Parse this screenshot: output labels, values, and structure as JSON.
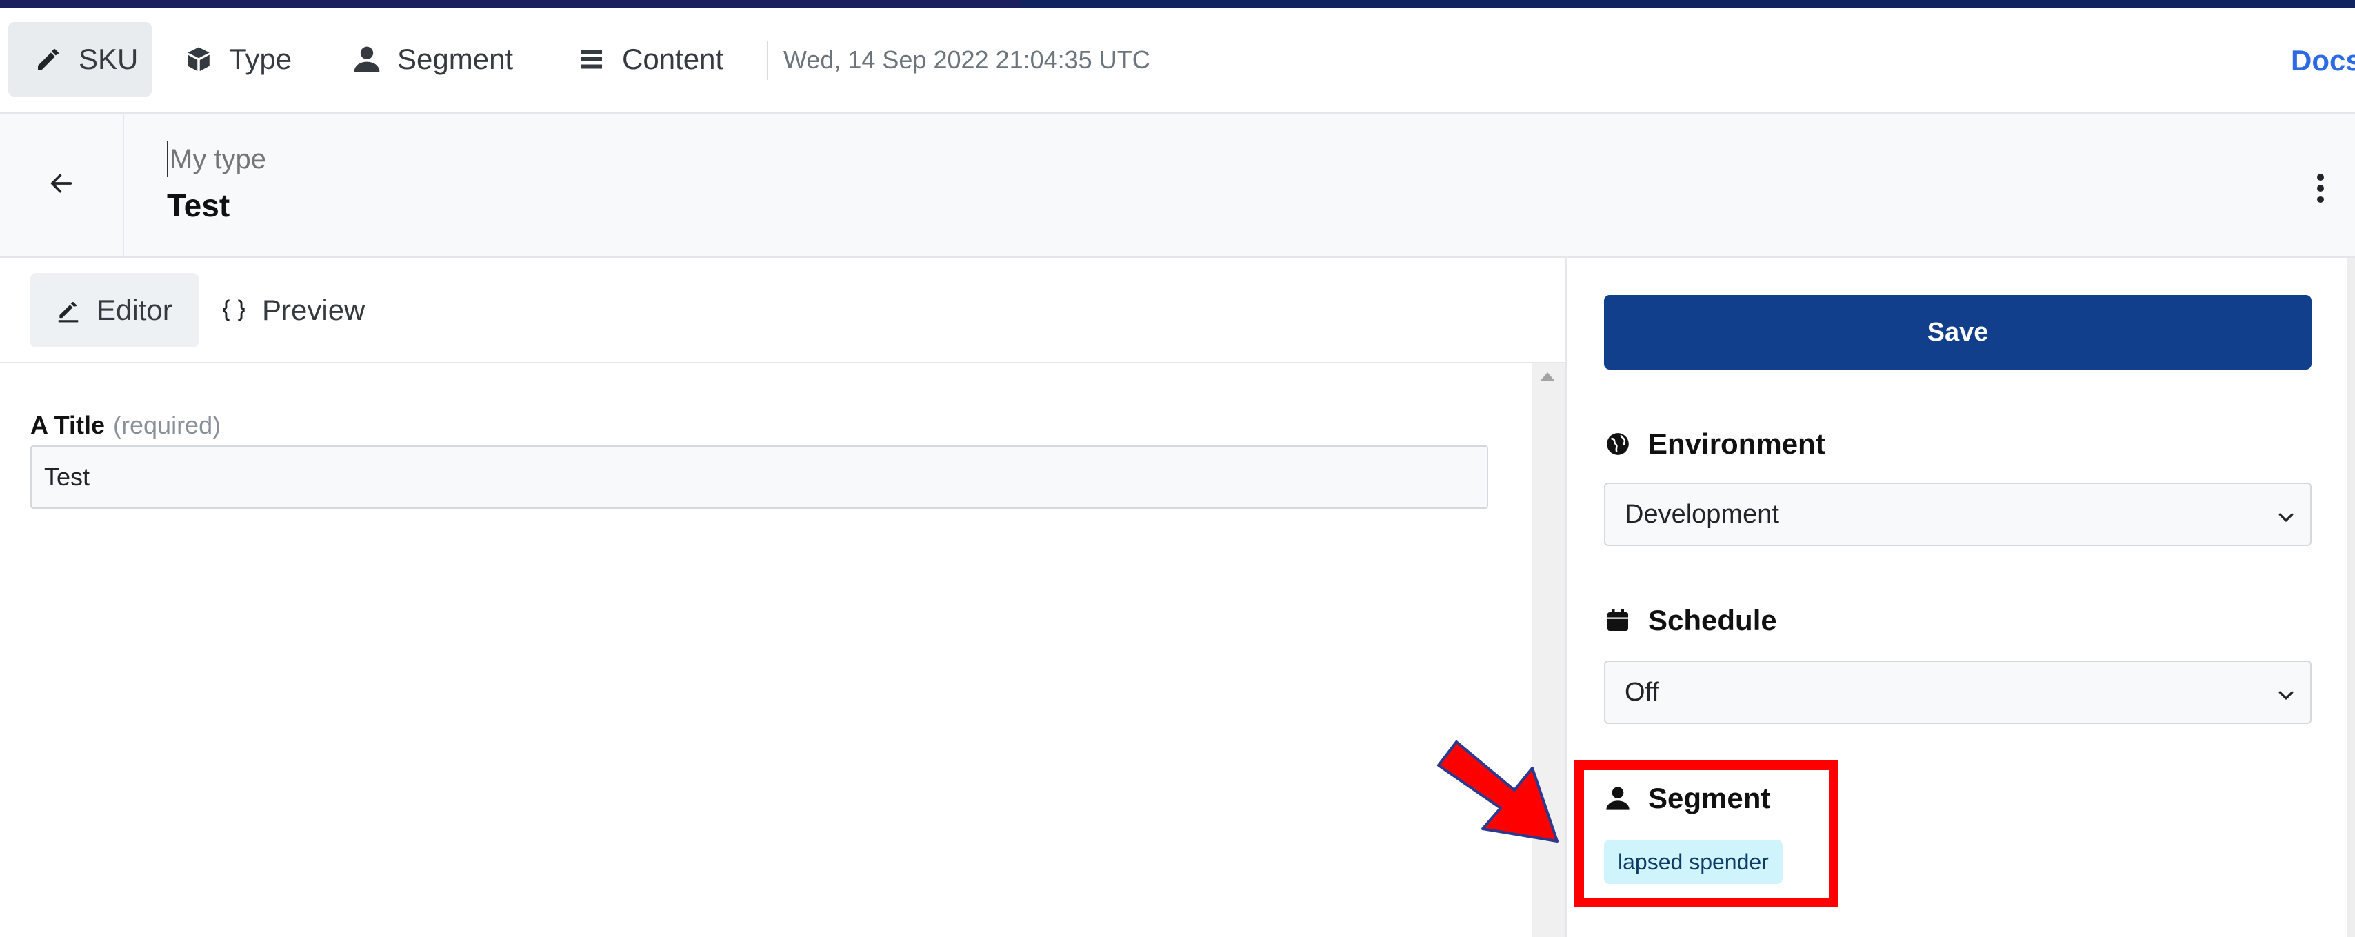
{
  "topnav": {
    "items": [
      {
        "label": "SKU",
        "icon": "pencil-icon",
        "active": true
      },
      {
        "label": "Type",
        "icon": "cube-icon"
      },
      {
        "label": "Segment",
        "icon": "user-icon"
      },
      {
        "label": "Content",
        "icon": "list-icon"
      }
    ],
    "timestamp": "Wed, 14 Sep 2022 21:04:35 UTC",
    "docs_label": "Docs"
  },
  "header": {
    "type_placeholder": "My type",
    "title": "Test"
  },
  "editor": {
    "tabs": [
      {
        "label": "Editor",
        "icon": "pencil-icon",
        "active": true
      },
      {
        "label": "Preview",
        "icon": "braces-icon"
      }
    ],
    "field": {
      "label": "A Title",
      "required_text": "(required)",
      "value": "Test"
    }
  },
  "sidebar": {
    "save_label": "Save",
    "environment": {
      "label": "Environment",
      "icon": "globe-icon",
      "value": "Development"
    },
    "schedule": {
      "label": "Schedule",
      "icon": "calendar-icon",
      "value": "Off"
    },
    "segment": {
      "label": "Segment",
      "icon": "user-icon",
      "badge": "lapsed spender"
    }
  },
  "colors": {
    "primary": "#123f8c",
    "link": "#2d6be4",
    "badge_bg": "#cff4fc",
    "annotation": "#ff0000"
  }
}
